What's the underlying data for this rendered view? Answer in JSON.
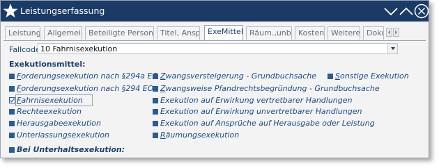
{
  "window": {
    "title": "Leistungserfassung",
    "app_icon": "star-icon",
    "controls": [
      "minimize-icon",
      "restore-icon",
      "close-icon"
    ]
  },
  "tabs": [
    {
      "label": "Leistung",
      "active": false
    },
    {
      "label": "Allgemein",
      "active": false
    },
    {
      "label": "Beteiligte Personen",
      "active": false
    },
    {
      "label": "Titel, Anspr.",
      "active": false
    },
    {
      "label": "ExeMittel",
      "active": true
    },
    {
      "label": "Räum.,unb.V.",
      "active": false
    },
    {
      "label": "Kosten",
      "active": false
    },
    {
      "label": "Weiteres",
      "active": false
    },
    {
      "label": "Doku",
      "active": false
    }
  ],
  "fallcode": {
    "label": "Fallcode",
    "value": "10 Fahrnisexekution"
  },
  "section_title": "Exekutionsmittel:",
  "columns": [
    {
      "items": [
        {
          "label": "Forderungsexekution nach §294a EO",
          "underline": "F",
          "rest": "orderungsexekution nach §294a EO",
          "checked": false
        },
        {
          "label": "Forderungsexekution nach §294 EO",
          "underline": "F",
          "rest": "orderungsexekution nach §294 EO",
          "checked": false
        },
        {
          "label": "Fahrnisexekution",
          "underline": "F",
          "rest": "ahrnisexekution",
          "checked": true
        },
        {
          "label": "Rechteexekution",
          "underline": "",
          "rest": "Rechteexekution",
          "checked": false
        },
        {
          "label": "Herausgabeexekution",
          "underline": "",
          "rest": "Herausgabeexekution",
          "checked": false
        },
        {
          "label": "Unterlassungsexekution",
          "underline": "",
          "rest": "Unterlassungsexekution",
          "checked": false
        }
      ]
    },
    {
      "items": [
        {
          "label": "Zwangsversteigerung - Grundbuchsache",
          "underline": "Z",
          "rest": "wangsversteigerung - Grundbuchsache",
          "checked": false
        },
        {
          "label": "Zwangsweise Pfandrechtsbegründung - Grundbuchsache",
          "underline": "Z",
          "rest": "wangsweise Pfandrechtsbegründung - Grundbuchsache",
          "checked": false
        },
        {
          "label": "Exekution auf Erwirkung vertretbarer Handlungen",
          "underline": "",
          "rest": "Exekution auf Erwirkung vertretbarer Handlungen",
          "checked": false
        },
        {
          "label": "Exekution auf Erwirkung unvertretbarer Handlungen",
          "underline": "",
          "rest": "Exekution auf Erwirkung unvertretbarer Handlungen",
          "checked": false
        },
        {
          "label": "Exekution auf Ansprüche auf Herausgabe oder Leistung",
          "underline": "",
          "rest": "Exekution auf Ansprüche auf Herausgabe oder Leistung",
          "checked": false
        },
        {
          "label": "Räumungsexekution",
          "underline": "R",
          "rest": "äumungsexekution",
          "checked": false
        }
      ]
    },
    {
      "items": [
        {
          "label": "Sonstige Exekution",
          "underline": "S",
          "rest": "onstige Exekution",
          "checked": false
        }
      ]
    }
  ],
  "subsection_title": "Bei Unterhaltsexekution:",
  "colors": {
    "titlebar": "#1c3a66",
    "accent_text": "#1b4a86",
    "bullet": "#2d5a93"
  }
}
